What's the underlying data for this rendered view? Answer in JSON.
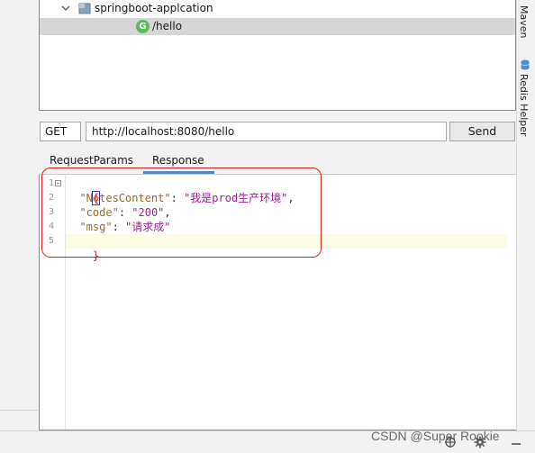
{
  "tree": {
    "project_label": "springboot-applcation",
    "endpoint_badge": "G",
    "endpoint_label": "/hello"
  },
  "request": {
    "method": "GET",
    "url": "http://localhost:8080/hello",
    "send_label": "Send"
  },
  "tabs": [
    {
      "label": "RequestParams"
    },
    {
      "label": "Response"
    }
  ],
  "editor": {
    "line_numbers": [
      "1",
      "2",
      "3",
      "4",
      "5"
    ],
    "open_brace": "{",
    "close_brace": "}",
    "lines": [
      {
        "key": "\"NotesContent\"",
        "value": "\"我是prod生产环境\"",
        "trail": ","
      },
      {
        "key": "\"code\"",
        "value": "\"200\"",
        "trail": ","
      },
      {
        "key": "\"msg\"",
        "value": "\"请求成\"",
        "trail": ""
      }
    ],
    "colon": ": "
  },
  "side_tools": {
    "maven_label": "Maven",
    "redis_label": "Redis Helper"
  },
  "watermark": "CSDN @Super Rookie",
  "icons": [
    "chevron-down-icon",
    "package-icon",
    "database-icon",
    "add-icon",
    "gear-icon",
    "minimize-icon"
  ],
  "colors": {
    "accent_tab": "#4a88c7",
    "annotation": "#e02020",
    "json_key": "#9b6a1a",
    "json_string": "#9b2393"
  }
}
